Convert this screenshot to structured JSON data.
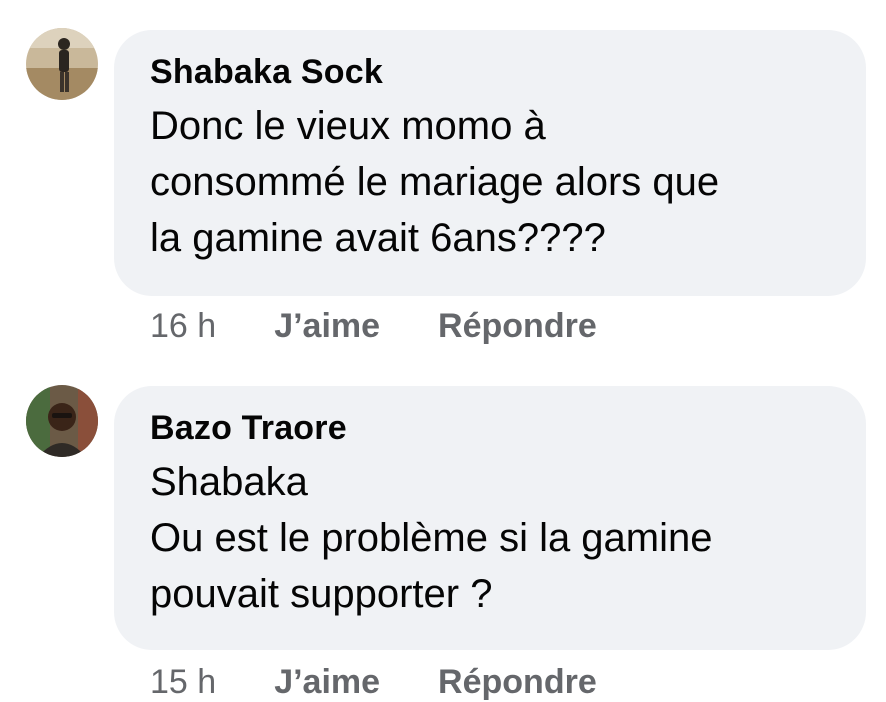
{
  "comments": [
    {
      "author": "Shabaka Sock",
      "avatar_icon": "user-photo-avatar",
      "lines": [
        "Donc le vieux momo à",
        "consommé le mariage alors que",
        "la gamine avait 6ans????"
      ],
      "time": "16 h",
      "like_label": "J’aime",
      "reply_label": "Répondre"
    },
    {
      "author": "Bazo Traore",
      "avatar_icon": "user-photo-avatar",
      "lines": [
        "Shabaka",
        "Ou est le problème si la gamine",
        "pouvait supporter ?"
      ],
      "time": "15 h",
      "like_label": "J’aime",
      "reply_label": "Répondre"
    }
  ],
  "colors": {
    "bubble_bg": "#f0f2f5",
    "text": "#050505",
    "meta": "#65676b"
  }
}
